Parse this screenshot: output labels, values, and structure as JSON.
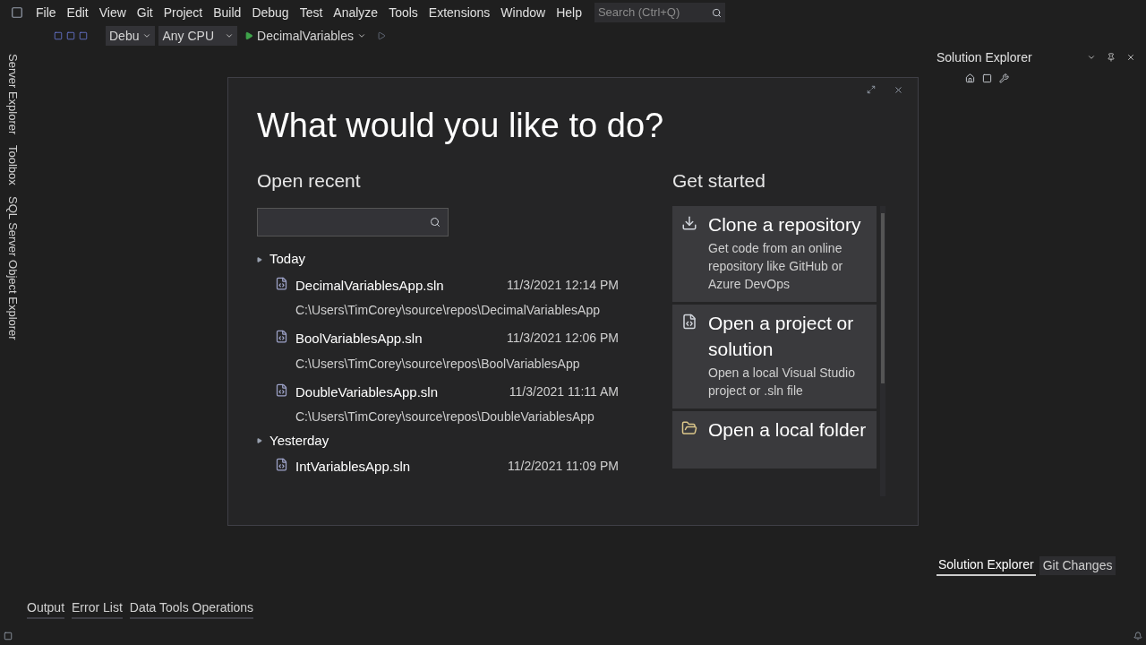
{
  "menu": [
    "File",
    "Edit",
    "View",
    "Git",
    "Project",
    "Build",
    "Debug",
    "Test",
    "Analyze",
    "Tools",
    "Extensions",
    "Window",
    "Help"
  ],
  "search": {
    "placeholder": "Search (Ctrl+Q)"
  },
  "toolbar": {
    "configuration": "Debu",
    "platform": "Any CPU",
    "startup": "DecimalVariables"
  },
  "left_tabs": [
    "Server Explorer",
    "Toolbox",
    "SQL Server Object Explorer"
  ],
  "solution_explorer": {
    "title": "Solution Explorer"
  },
  "dialog": {
    "title": "What would you like to do?",
    "open_recent": {
      "heading": "Open recent",
      "groups": [
        {
          "label": "Today",
          "expanded": true,
          "items": [
            {
              "name": "DecimalVariablesApp.sln",
              "date": "11/3/2021 12:14 PM",
              "path": "C:\\Users\\TimCorey\\source\\repos\\DecimalVariablesApp"
            },
            {
              "name": "BoolVariablesApp.sln",
              "date": "11/3/2021 12:06 PM",
              "path": "C:\\Users\\TimCorey\\source\\repos\\BoolVariablesApp"
            },
            {
              "name": "DoubleVariablesApp.sln",
              "date": "11/3/2021 11:11 AM",
              "path": "C:\\Users\\TimCorey\\source\\repos\\DoubleVariablesApp"
            }
          ]
        },
        {
          "label": "Yesterday",
          "expanded": true,
          "items": [
            {
              "name": "IntVariablesApp.sln",
              "date": "11/2/2021 11:09 PM"
            }
          ]
        }
      ]
    },
    "get_started": {
      "heading": "Get started",
      "actions": [
        {
          "kind": "clone",
          "title": "Clone a repository",
          "description": "Get code from an online repository like GitHub or Azure DevOps"
        },
        {
          "kind": "project",
          "title": "Open a project or solution",
          "description": "Open a local Visual Studio project or .sln file"
        },
        {
          "kind": "folder",
          "title": "Open a local folder"
        }
      ]
    }
  },
  "bottom_tabs": [
    "Output",
    "Error List",
    "Data Tools Operations"
  ],
  "right_tabs": [
    {
      "label": "Solution Explorer",
      "selected": true
    },
    {
      "label": "Git Changes",
      "selected": false
    }
  ]
}
